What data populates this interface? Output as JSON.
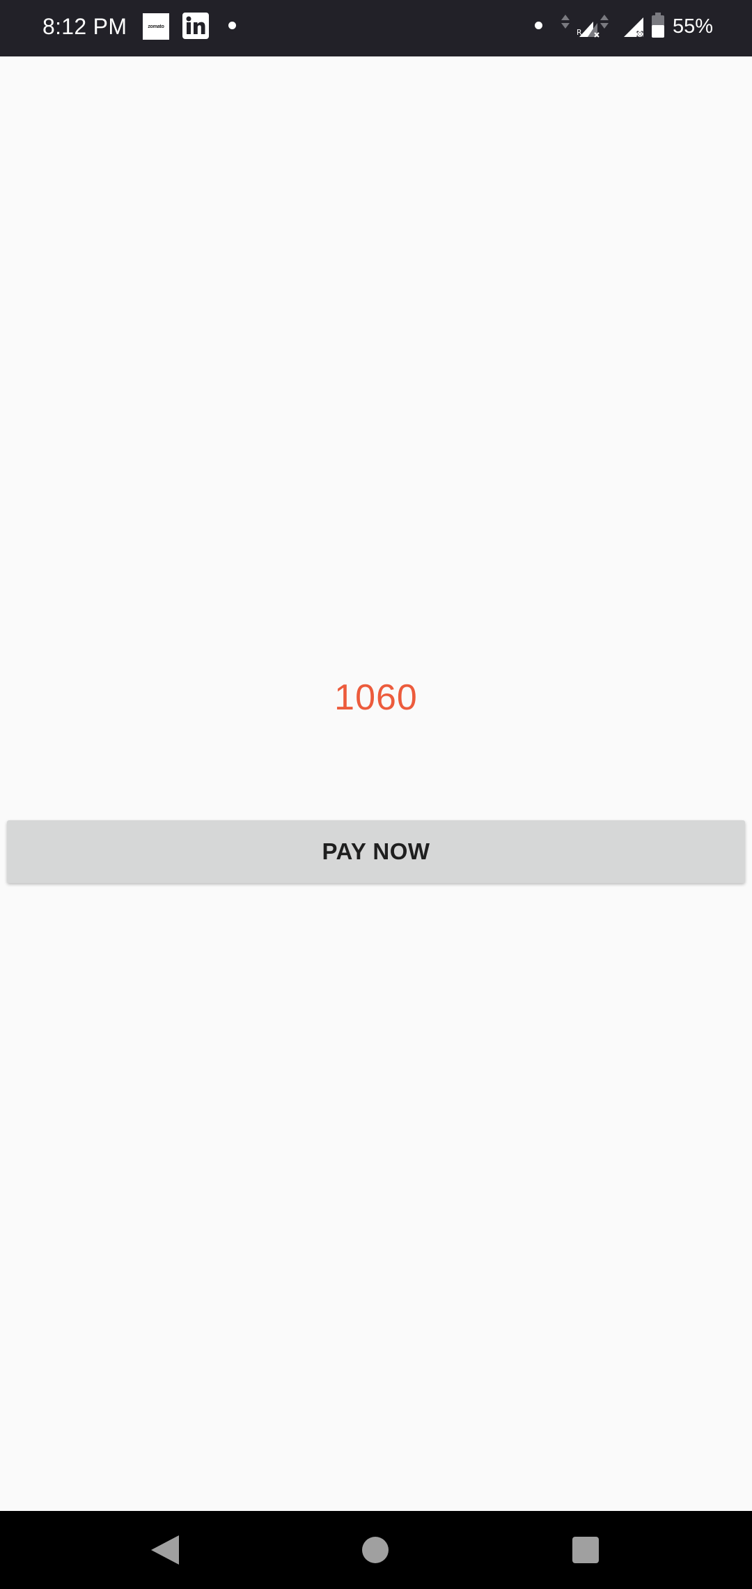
{
  "status_bar": {
    "time": "8:12 PM",
    "notification_icons": [
      "zomato-icon",
      "linkedin-icon",
      "dot-icon"
    ],
    "zomato_label": "zomato",
    "system_icons": [
      "dot-icon",
      "data-arrows-icon",
      "signal-roaming-icon",
      "signal-icon",
      "battery-icon"
    ],
    "battery_percent": "55%"
  },
  "main": {
    "amount": "1060",
    "pay_button_label": "PAY NOW"
  },
  "nav_bar": {
    "icons": [
      "back-icon",
      "home-icon",
      "recents-icon"
    ]
  },
  "colors": {
    "status_bar_bg": "#222128",
    "page_bg": "#fafafa",
    "amount_text": "#ec5b3c",
    "button_bg": "#d6d7d7",
    "button_text": "#1f1f1f",
    "nav_bar_bg": "#000000",
    "nav_icon": "#a0a0a0"
  }
}
